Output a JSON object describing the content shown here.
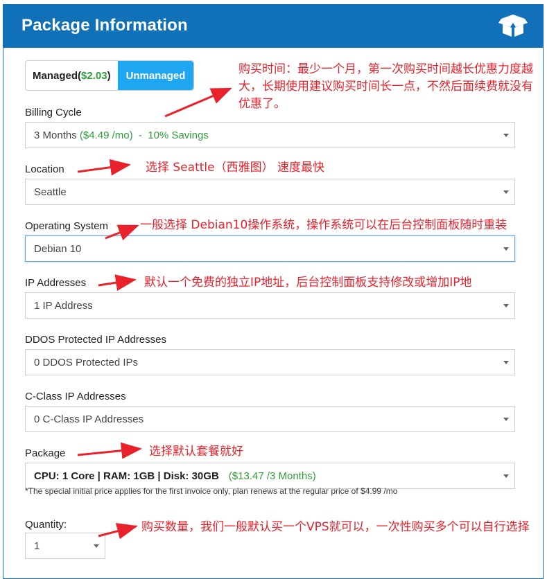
{
  "header": {
    "title": "Package Information",
    "icon": "box-icon"
  },
  "toggle": {
    "managed_label": "Managed(",
    "managed_price": "$2.03",
    "managed_close": ")",
    "unmanaged_label": "Unmanaged"
  },
  "fields": {
    "billing": {
      "label": "Billing Cycle",
      "value_prefix": "3 Months ",
      "value_price": "($4.49 /mo)",
      "value_suffix": "  -  10% Savings"
    },
    "location": {
      "label": "Location",
      "value": "Seattle"
    },
    "os": {
      "label": "Operating System",
      "value": "Debian 10"
    },
    "ip": {
      "label": "IP Addresses",
      "value": "1 IP Address"
    },
    "ddos": {
      "label": "DDOS Protected IP Addresses",
      "value": "0 DDOS Protected IPs"
    },
    "cclass": {
      "label": "C-Class IP Addresses",
      "value": "0 C-Class IP Addresses"
    },
    "package": {
      "label": "Package",
      "value_spec": "CPU: 1 Core | RAM: 1GB | Disk: 30GB",
      "value_price": "($13.47 /3 Months)"
    },
    "note": "*The special initial price applies for the first invoice only, plan renews at the regular price of $4.99 /mo",
    "quantity": {
      "label": "Quantity:",
      "value": "1"
    }
  },
  "annotations": {
    "billing": "购买时间：最少一个月，第一次购买时间越长优惠力度越大，长期使用建议购买时间长一点，不然后面续费就没有优惠了。",
    "location": "选择 Seattle（西雅图） 速度最快",
    "os": "一般选择 Debian10操作系统，操作系统可以在后台控制面板随时重装",
    "ip": "默认一个免费的独立IP地址，后台控制面板支持修改或增加IP地",
    "package": "选择默认套餐就好",
    "quantity": "购买数量，我们一般默认买一个VPS就可以，一次性购买多个可以自行选择"
  },
  "colors": {
    "header": "#1070b8",
    "accent": "#1ea6f0",
    "price_green": "#2f9e3b",
    "annotation_red": "#e8212b"
  }
}
